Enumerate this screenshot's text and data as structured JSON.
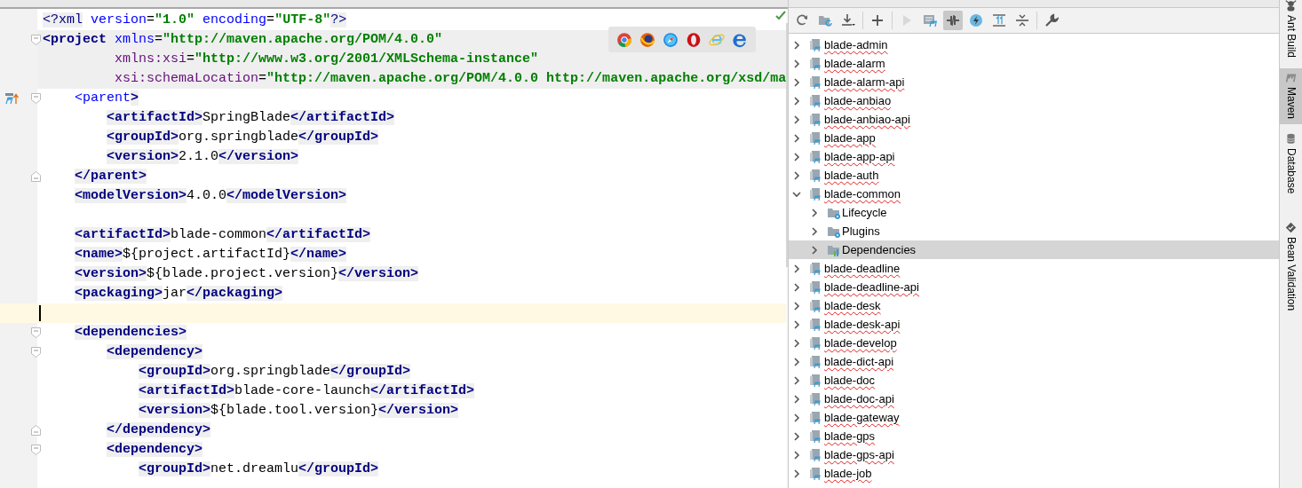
{
  "editor": {
    "lines": [
      {
        "band": false,
        "current": false,
        "text": "<?xml version=\"1.0\" encoding=\"UTF-8\"?>"
      },
      {
        "band": true,
        "current": false,
        "fold_start": true,
        "text": "<project xmlns=\"http://maven.apache.org/POM/4.0.0\""
      },
      {
        "band": true,
        "current": false,
        "text": "         xmlns:xsi=\"http://www.w3.org/2001/XMLSchema-instance\""
      },
      {
        "band": true,
        "current": false,
        "text": "         xsi:schemaLocation=\"http://maven.apache.org/POM/4.0.0 http://maven.apache.org/xsd/ma"
      },
      {
        "band": false,
        "current": false,
        "fold_start": true,
        "overrides": true,
        "text": "    <parent>"
      },
      {
        "band": false,
        "current": false,
        "text": "        <artifactId>SpringBlade</artifactId>"
      },
      {
        "band": false,
        "current": false,
        "text": "        <groupId>org.springblade</groupId>"
      },
      {
        "band": false,
        "current": false,
        "text": "        <version>2.1.0</version>"
      },
      {
        "band": false,
        "current": false,
        "fold_end": true,
        "text": "    </parent>"
      },
      {
        "band": false,
        "current": false,
        "text": "    <modelVersion>4.0.0</modelVersion>"
      },
      {
        "band": false,
        "current": false
      },
      {
        "band": false,
        "current": false,
        "text": "    <artifactId>blade-common</artifactId>"
      },
      {
        "band": false,
        "current": false,
        "text": "    <name>${project.artifactId}</name>"
      },
      {
        "band": false,
        "current": false,
        "text": "    <version>${blade.project.version}</version>"
      },
      {
        "band": false,
        "current": false,
        "text": "    <packaging>jar</packaging>"
      },
      {
        "band": false,
        "current": true
      },
      {
        "band": false,
        "current": false,
        "fold_start": true,
        "text": "    <dependencies>"
      },
      {
        "band": false,
        "current": false,
        "fold_start": true,
        "text": "        <dependency>"
      },
      {
        "band": false,
        "current": false,
        "text": "            <groupId>org.springblade</groupId>"
      },
      {
        "band": false,
        "current": false,
        "text": "            <artifactId>blade-core-launch</artifactId>"
      },
      {
        "band": false,
        "current": false,
        "text": "            <version>${blade.tool.version}</version>"
      },
      {
        "band": false,
        "current": false,
        "fold_end": true,
        "text": "        </dependency>"
      },
      {
        "band": false,
        "current": false,
        "fold_start": true,
        "text": "        <dependency>"
      },
      {
        "band": false,
        "current": false,
        "text": "            <groupId>net.dreamlu</groupId>"
      }
    ],
    "browsers": [
      {
        "kind": "chrome"
      },
      {
        "kind": "firefox"
      },
      {
        "kind": "safari"
      },
      {
        "kind": "opera"
      },
      {
        "kind": "ie"
      },
      {
        "kind": "edge"
      }
    ]
  },
  "maven": {
    "toolbar": [
      {
        "kind": "reimport",
        "selected": false,
        "disabled": false
      },
      {
        "kind": "sources",
        "selected": false,
        "disabled": false
      },
      {
        "kind": "download",
        "selected": false,
        "disabled": false,
        "sep": true
      },
      {
        "kind": "add",
        "selected": false,
        "disabled": false,
        "sep": true
      },
      {
        "kind": "run",
        "selected": false,
        "disabled": true
      },
      {
        "kind": "goal",
        "selected": false,
        "disabled": false
      },
      {
        "kind": "offline",
        "selected": true,
        "disabled": false
      },
      {
        "kind": "skip",
        "selected": false,
        "disabled": false
      },
      {
        "kind": "expand",
        "selected": false,
        "disabled": false
      },
      {
        "kind": "collapse",
        "selected": false,
        "disabled": false,
        "sep": true
      },
      {
        "kind": "settings",
        "selected": false,
        "disabled": false
      }
    ],
    "tree": [
      {
        "label": "blade-admin",
        "kind": "module",
        "expanded": false,
        "selected": false,
        "spell_error": true
      },
      {
        "label": "blade-alarm",
        "kind": "module",
        "expanded": false,
        "selected": false,
        "spell_error": true
      },
      {
        "label": "blade-alarm-api",
        "kind": "module",
        "expanded": false,
        "selected": false,
        "spell_error": true
      },
      {
        "label": "blade-anbiao",
        "kind": "module",
        "expanded": false,
        "selected": false,
        "spell_error": true
      },
      {
        "label": "blade-anbiao-api",
        "kind": "module",
        "expanded": false,
        "selected": false,
        "spell_error": true
      },
      {
        "label": "blade-app",
        "kind": "module",
        "expanded": false,
        "selected": false,
        "spell_error": true
      },
      {
        "label": "blade-app-api",
        "kind": "module",
        "expanded": false,
        "selected": false,
        "spell_error": true
      },
      {
        "label": "blade-auth",
        "kind": "module",
        "expanded": false,
        "selected": false,
        "spell_error": true
      },
      {
        "label": "blade-common",
        "kind": "module",
        "expanded": true,
        "selected": false,
        "spell_error": true,
        "children": [
          {
            "label": "Lifecycle",
            "kind": "lifecycle",
            "expanded": false,
            "selected": false,
            "spell_error": false
          },
          {
            "label": "Plugins",
            "kind": "plugins",
            "expanded": false,
            "selected": false,
            "spell_error": false
          },
          {
            "label": "Dependencies",
            "kind": "dependencies",
            "expanded": false,
            "selected": true,
            "spell_error": false
          }
        ]
      },
      {
        "label": "blade-deadline",
        "kind": "module",
        "expanded": false,
        "selected": false,
        "spell_error": true
      },
      {
        "label": "blade-deadline-api",
        "kind": "module",
        "expanded": false,
        "selected": false,
        "spell_error": true
      },
      {
        "label": "blade-desk",
        "kind": "module",
        "expanded": false,
        "selected": false,
        "spell_error": true
      },
      {
        "label": "blade-desk-api",
        "kind": "module",
        "expanded": false,
        "selected": false,
        "spell_error": true
      },
      {
        "label": "blade-develop",
        "kind": "module",
        "expanded": false,
        "selected": false,
        "spell_error": true
      },
      {
        "label": "blade-dict-api",
        "kind": "module",
        "expanded": false,
        "selected": false,
        "spell_error": true
      },
      {
        "label": "blade-doc",
        "kind": "module",
        "expanded": false,
        "selected": false,
        "spell_error": true
      },
      {
        "label": "blade-doc-api",
        "kind": "module",
        "expanded": false,
        "selected": false,
        "spell_error": true
      },
      {
        "label": "blade-gateway",
        "kind": "module",
        "expanded": false,
        "selected": false,
        "spell_error": true
      },
      {
        "label": "blade-gps",
        "kind": "module",
        "expanded": false,
        "selected": false,
        "spell_error": true
      },
      {
        "label": "blade-gps-api",
        "kind": "module",
        "expanded": false,
        "selected": false,
        "spell_error": true
      },
      {
        "label": "blade-job",
        "kind": "module",
        "expanded": false,
        "selected": false,
        "spell_error": true
      }
    ]
  },
  "side_tabs": [
    {
      "label": "Ant Build",
      "kind": "ant",
      "selected": false
    },
    {
      "label": "Maven",
      "kind": "maven",
      "selected": true
    },
    {
      "label": "Database",
      "kind": "database",
      "selected": false
    },
    {
      "label": "Bean Validation",
      "kind": "bean",
      "selected": false
    }
  ]
}
